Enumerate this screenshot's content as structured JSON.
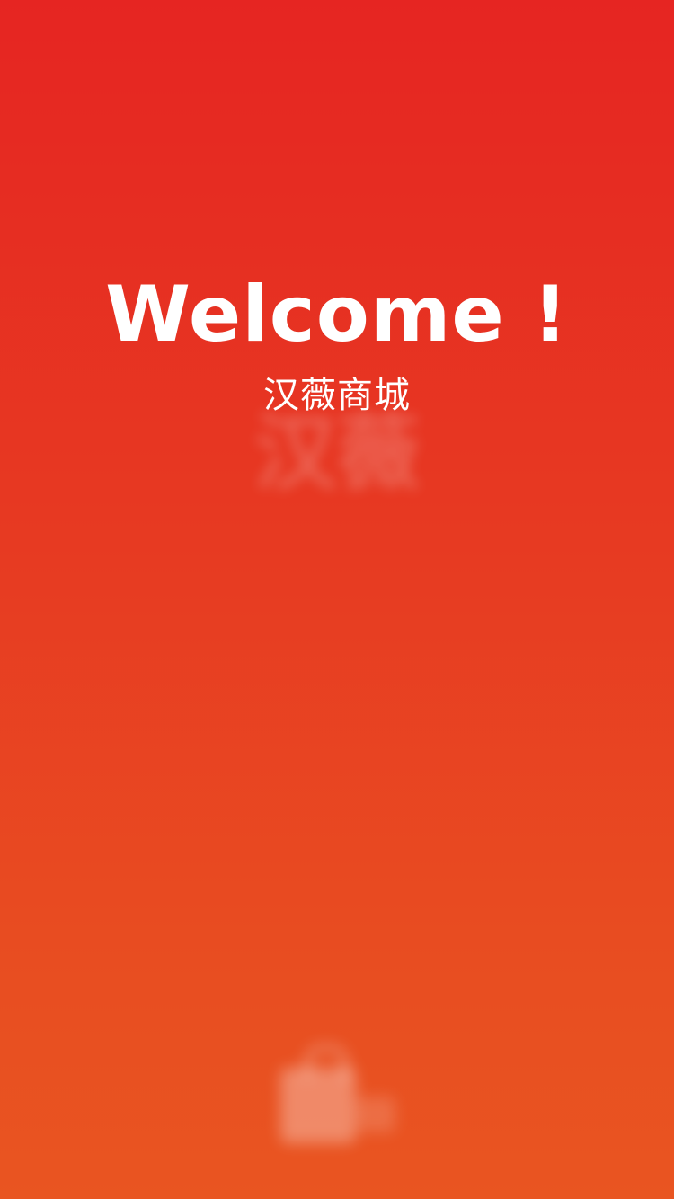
{
  "splash": {
    "welcome_text": "Welcome !",
    "subtitle": "汉薇商城",
    "watermark_text": "汉薇",
    "logo_icon": "shopping-bag-icon"
  },
  "colors": {
    "gradient_top": "#e62522",
    "gradient_bottom": "#e95521",
    "text": "#ffffff"
  }
}
